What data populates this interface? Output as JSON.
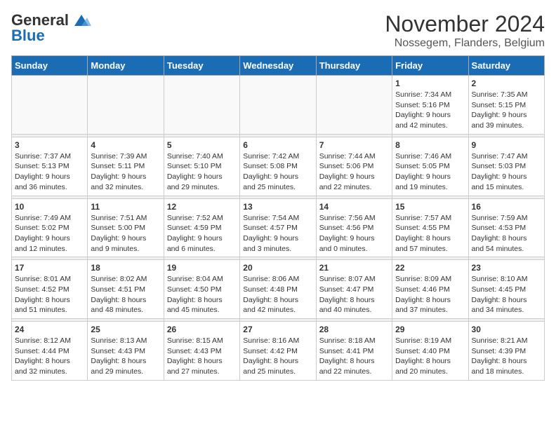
{
  "logo": {
    "line1": "General",
    "line2": "Blue"
  },
  "title": "November 2024",
  "subtitle": "Nossegem, Flanders, Belgium",
  "weekdays": [
    "Sunday",
    "Monday",
    "Tuesday",
    "Wednesday",
    "Thursday",
    "Friday",
    "Saturday"
  ],
  "weeks": [
    [
      {
        "day": "",
        "info": ""
      },
      {
        "day": "",
        "info": ""
      },
      {
        "day": "",
        "info": ""
      },
      {
        "day": "",
        "info": ""
      },
      {
        "day": "",
        "info": ""
      },
      {
        "day": "1",
        "info": "Sunrise: 7:34 AM\nSunset: 5:16 PM\nDaylight: 9 hours\nand 42 minutes."
      },
      {
        "day": "2",
        "info": "Sunrise: 7:35 AM\nSunset: 5:15 PM\nDaylight: 9 hours\nand 39 minutes."
      }
    ],
    [
      {
        "day": "3",
        "info": "Sunrise: 7:37 AM\nSunset: 5:13 PM\nDaylight: 9 hours\nand 36 minutes."
      },
      {
        "day": "4",
        "info": "Sunrise: 7:39 AM\nSunset: 5:11 PM\nDaylight: 9 hours\nand 32 minutes."
      },
      {
        "day": "5",
        "info": "Sunrise: 7:40 AM\nSunset: 5:10 PM\nDaylight: 9 hours\nand 29 minutes."
      },
      {
        "day": "6",
        "info": "Sunrise: 7:42 AM\nSunset: 5:08 PM\nDaylight: 9 hours\nand 25 minutes."
      },
      {
        "day": "7",
        "info": "Sunrise: 7:44 AM\nSunset: 5:06 PM\nDaylight: 9 hours\nand 22 minutes."
      },
      {
        "day": "8",
        "info": "Sunrise: 7:46 AM\nSunset: 5:05 PM\nDaylight: 9 hours\nand 19 minutes."
      },
      {
        "day": "9",
        "info": "Sunrise: 7:47 AM\nSunset: 5:03 PM\nDaylight: 9 hours\nand 15 minutes."
      }
    ],
    [
      {
        "day": "10",
        "info": "Sunrise: 7:49 AM\nSunset: 5:02 PM\nDaylight: 9 hours\nand 12 minutes."
      },
      {
        "day": "11",
        "info": "Sunrise: 7:51 AM\nSunset: 5:00 PM\nDaylight: 9 hours\nand 9 minutes."
      },
      {
        "day": "12",
        "info": "Sunrise: 7:52 AM\nSunset: 4:59 PM\nDaylight: 9 hours\nand 6 minutes."
      },
      {
        "day": "13",
        "info": "Sunrise: 7:54 AM\nSunset: 4:57 PM\nDaylight: 9 hours\nand 3 minutes."
      },
      {
        "day": "14",
        "info": "Sunrise: 7:56 AM\nSunset: 4:56 PM\nDaylight: 9 hours\nand 0 minutes."
      },
      {
        "day": "15",
        "info": "Sunrise: 7:57 AM\nSunset: 4:55 PM\nDaylight: 8 hours\nand 57 minutes."
      },
      {
        "day": "16",
        "info": "Sunrise: 7:59 AM\nSunset: 4:53 PM\nDaylight: 8 hours\nand 54 minutes."
      }
    ],
    [
      {
        "day": "17",
        "info": "Sunrise: 8:01 AM\nSunset: 4:52 PM\nDaylight: 8 hours\nand 51 minutes."
      },
      {
        "day": "18",
        "info": "Sunrise: 8:02 AM\nSunset: 4:51 PM\nDaylight: 8 hours\nand 48 minutes."
      },
      {
        "day": "19",
        "info": "Sunrise: 8:04 AM\nSunset: 4:50 PM\nDaylight: 8 hours\nand 45 minutes."
      },
      {
        "day": "20",
        "info": "Sunrise: 8:06 AM\nSunset: 4:48 PM\nDaylight: 8 hours\nand 42 minutes."
      },
      {
        "day": "21",
        "info": "Sunrise: 8:07 AM\nSunset: 4:47 PM\nDaylight: 8 hours\nand 40 minutes."
      },
      {
        "day": "22",
        "info": "Sunrise: 8:09 AM\nSunset: 4:46 PM\nDaylight: 8 hours\nand 37 minutes."
      },
      {
        "day": "23",
        "info": "Sunrise: 8:10 AM\nSunset: 4:45 PM\nDaylight: 8 hours\nand 34 minutes."
      }
    ],
    [
      {
        "day": "24",
        "info": "Sunrise: 8:12 AM\nSunset: 4:44 PM\nDaylight: 8 hours\nand 32 minutes."
      },
      {
        "day": "25",
        "info": "Sunrise: 8:13 AM\nSunset: 4:43 PM\nDaylight: 8 hours\nand 29 minutes."
      },
      {
        "day": "26",
        "info": "Sunrise: 8:15 AM\nSunset: 4:43 PM\nDaylight: 8 hours\nand 27 minutes."
      },
      {
        "day": "27",
        "info": "Sunrise: 8:16 AM\nSunset: 4:42 PM\nDaylight: 8 hours\nand 25 minutes."
      },
      {
        "day": "28",
        "info": "Sunrise: 8:18 AM\nSunset: 4:41 PM\nDaylight: 8 hours\nand 22 minutes."
      },
      {
        "day": "29",
        "info": "Sunrise: 8:19 AM\nSunset: 4:40 PM\nDaylight: 8 hours\nand 20 minutes."
      },
      {
        "day": "30",
        "info": "Sunrise: 8:21 AM\nSunset: 4:39 PM\nDaylight: 8 hours\nand 18 minutes."
      }
    ]
  ]
}
